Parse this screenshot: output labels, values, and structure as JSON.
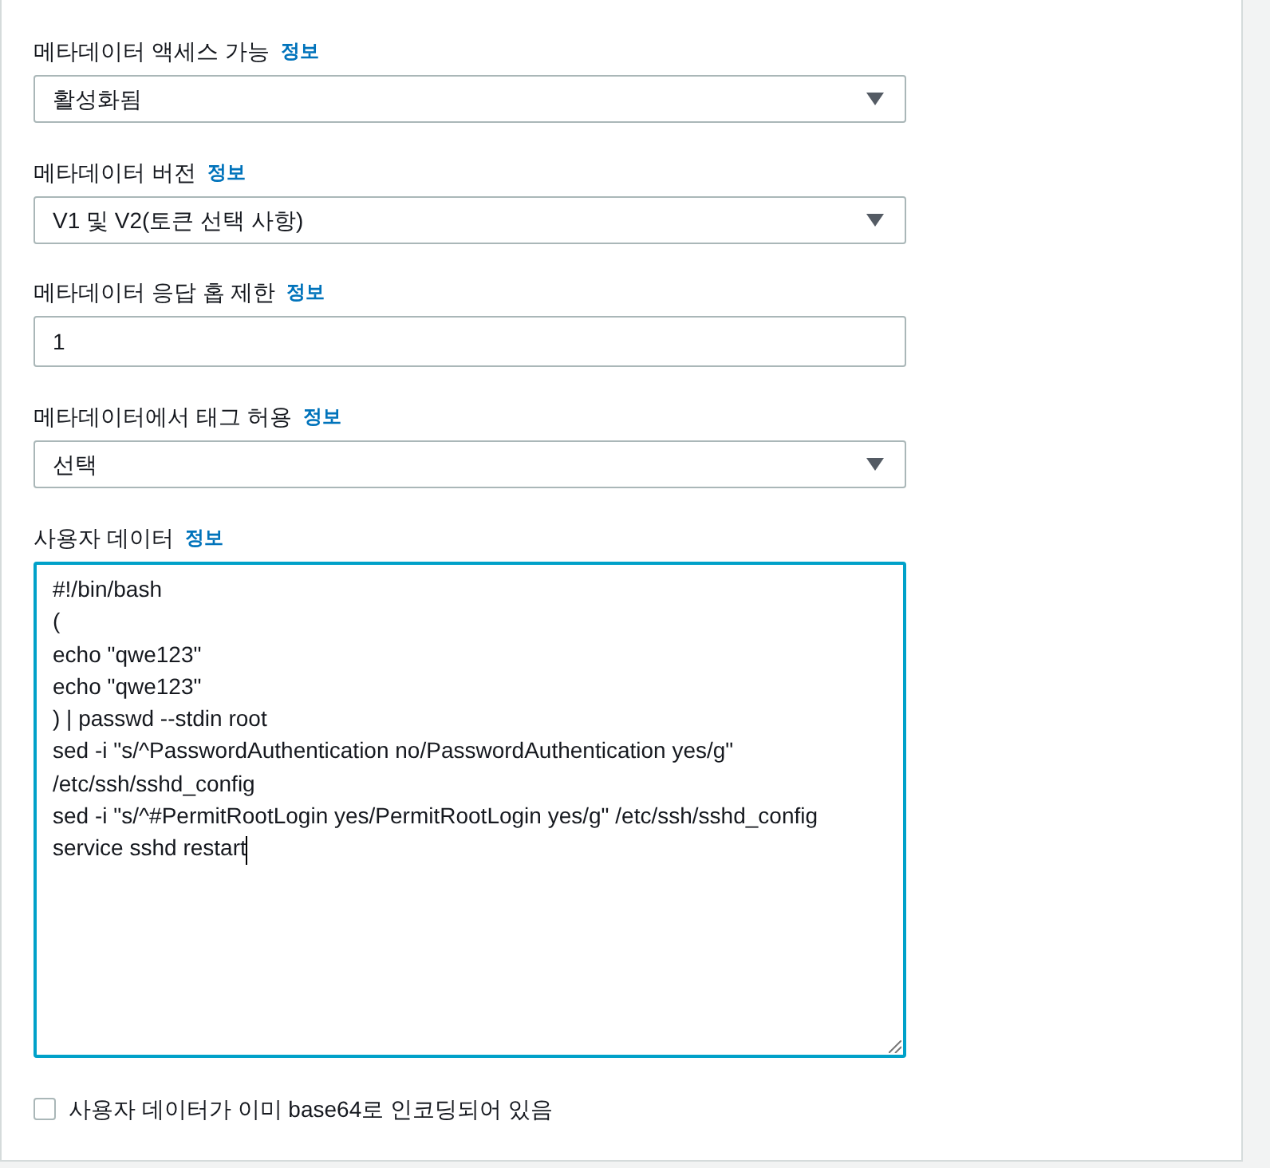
{
  "fields": [
    {
      "kind": "select",
      "label": "메타데이터 액세스 가능",
      "info": "정보",
      "value": "활성화됨",
      "focused": false
    },
    {
      "kind": "select",
      "label": "메타데이터 버전",
      "info": "정보",
      "value": "V1 및 V2(토큰 선택 사항)",
      "focused": false
    },
    {
      "kind": "input",
      "label": "메타데이터 응답 홉 제한",
      "info": "정보",
      "value": "1",
      "focused": false
    },
    {
      "kind": "select",
      "label": "메타데이터에서 태그 허용",
      "info": "정보",
      "value": "선택",
      "focused": false
    },
    {
      "kind": "textarea",
      "label": "사용자 데이터",
      "info": "정보",
      "value": "#!/bin/bash\n(\necho \"qwe123\"\necho \"qwe123\"\n) | passwd --stdin root\nsed -i \"s/^PasswordAuthentication no/PasswordAuthentication yes/g\" /etc/ssh/sshd_config\nsed -i \"s/^#PermitRootLogin yes/PermitRootLogin yes/g\" /etc/ssh/sshd_config\nservice sshd restart",
      "focused": true
    }
  ],
  "checkbox": {
    "label": "사용자 데이터가 이미 base64로 인코딩되어 있음",
    "checked": false
  }
}
